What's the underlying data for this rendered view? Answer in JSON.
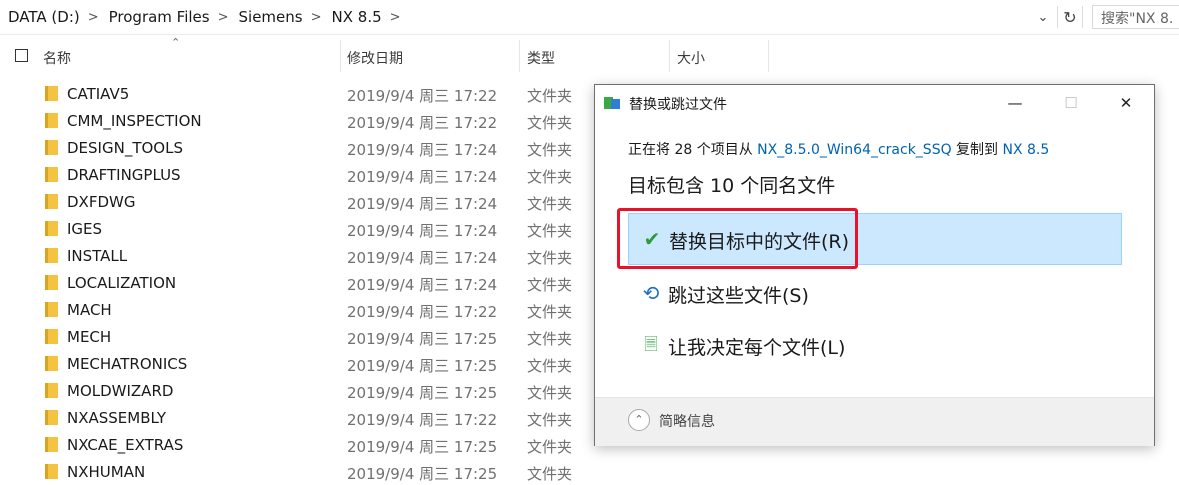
{
  "address_bar": {
    "crumbs": [
      "DATA (D:)",
      "Program Files",
      "Siemens",
      "NX 8.5"
    ],
    "dropdown_icon": "chevron-down-icon",
    "refresh_icon": "refresh-icon",
    "search_placeholder": "搜索\"NX 8."
  },
  "columns": {
    "name": "名称",
    "modified": "修改日期",
    "type": "类型",
    "size": "大小"
  },
  "files": [
    {
      "name": "CATIAV5",
      "date": "2019/9/4 周三 17:22",
      "type": "文件夹"
    },
    {
      "name": "CMM_INSPECTION",
      "date": "2019/9/4 周三 17:22",
      "type": "文件夹"
    },
    {
      "name": "DESIGN_TOOLS",
      "date": "2019/9/4 周三 17:24",
      "type": "文件夹"
    },
    {
      "name": "DRAFTINGPLUS",
      "date": "2019/9/4 周三 17:24",
      "type": "文件夹"
    },
    {
      "name": "DXFDWG",
      "date": "2019/9/4 周三 17:24",
      "type": "文件夹"
    },
    {
      "name": "IGES",
      "date": "2019/9/4 周三 17:24",
      "type": "文件夹"
    },
    {
      "name": "INSTALL",
      "date": "2019/9/4 周三 17:24",
      "type": "文件夹"
    },
    {
      "name": "LOCALIZATION",
      "date": "2019/9/4 周三 17:24",
      "type": "文件夹"
    },
    {
      "name": "MACH",
      "date": "2019/9/4 周三 17:22",
      "type": "文件夹"
    },
    {
      "name": "MECH",
      "date": "2019/9/4 周三 17:25",
      "type": "文件夹"
    },
    {
      "name": "MECHATRONICS",
      "date": "2019/9/4 周三 17:25",
      "type": "文件夹"
    },
    {
      "name": "MOLDWIZARD",
      "date": "2019/9/4 周三 17:25",
      "type": "文件夹"
    },
    {
      "name": "NXASSEMBLY",
      "date": "2019/9/4 周三 17:22",
      "type": "文件夹"
    },
    {
      "name": "NXCAE_EXTRAS",
      "date": "2019/9/4 周三 17:25",
      "type": "文件夹"
    },
    {
      "name": "NXHUMAN",
      "date": "2019/9/4 周三 17:25",
      "type": "文件夹"
    }
  ],
  "dialog": {
    "title": "替换或跳过文件",
    "copy_prefix": "正在将 28 个项目从 ",
    "source": "NX_8.5.0_Win64_crack_SSQ",
    "copy_middle": " 复制到 ",
    "destination": "NX 8.5",
    "heading": "目标包含 10 个同名文件",
    "options": {
      "replace": "替换目标中的文件(R)",
      "skip": "跳过这些文件(S)",
      "decide": "让我决定每个文件(L)"
    },
    "details_label": "简略信息",
    "colors": {
      "highlight": "#e8132b",
      "selected_bg": "#cce8ff",
      "link": "#0063b1"
    }
  }
}
